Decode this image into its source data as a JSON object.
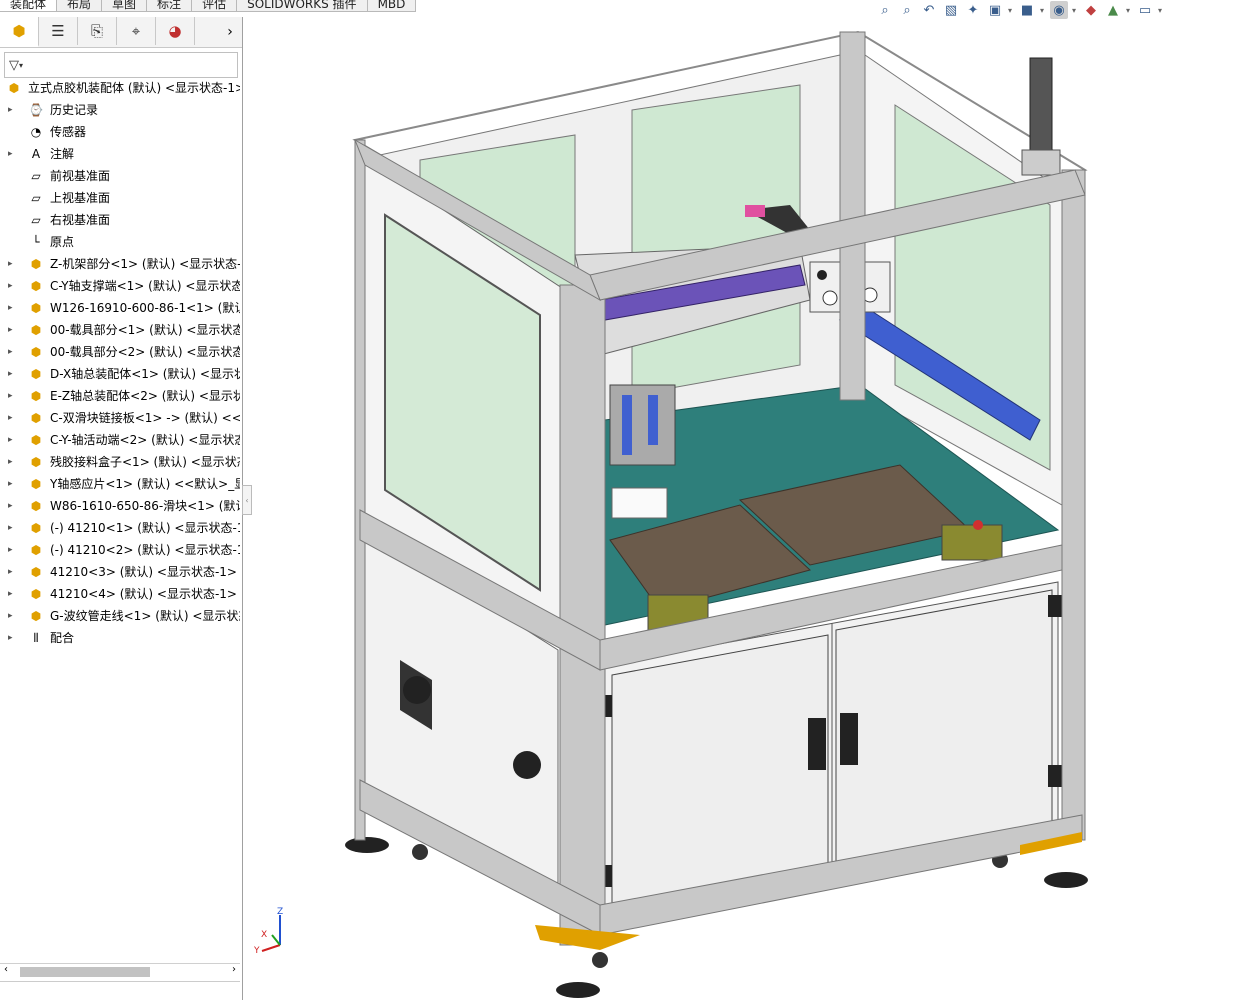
{
  "tabs": [
    "装配体",
    "布局",
    "草图",
    "标注",
    "评估",
    "SOLIDWORKS 插件",
    "MBD"
  ],
  "panel_tabs": [
    "feature-manager",
    "property-manager",
    "configuration-manager",
    "dimxpert-manager",
    "display-manager"
  ],
  "tree": {
    "root": "立式点胶机装配体 (默认) <显示状态-1>",
    "items": [
      {
        "label": "历史记录",
        "icon": "history-icon",
        "expand": true
      },
      {
        "label": "传感器",
        "icon": "sensor-icon",
        "expand": false
      },
      {
        "label": "注解",
        "icon": "annotation-icon",
        "expand": true
      },
      {
        "label": "前视基准面",
        "icon": "plane-icon",
        "expand": false
      },
      {
        "label": "上视基准面",
        "icon": "plane-icon",
        "expand": false
      },
      {
        "label": "右视基准面",
        "icon": "plane-icon",
        "expand": false
      },
      {
        "label": "原点",
        "icon": "origin-icon",
        "expand": false
      },
      {
        "label": "Z-机架部分<1> (默认) <显示状态-1",
        "icon": "subassembly-icon",
        "expand": true
      },
      {
        "label": "C-Y轴支撑端<1> (默认) <显示状态",
        "icon": "subassembly-icon",
        "expand": true
      },
      {
        "label": "W126-16910-600-86-1<1> (默认)",
        "icon": "subassembly-icon",
        "expand": true
      },
      {
        "label": "00-载具部分<1> (默认) <显示状态",
        "icon": "subassembly-icon",
        "expand": true
      },
      {
        "label": "00-载具部分<2> (默认) <显示状态",
        "icon": "subassembly-icon",
        "expand": true
      },
      {
        "label": "D-X轴总装配体<1> (默认) <显示状",
        "icon": "subassembly-icon",
        "expand": true
      },
      {
        "label": "E-Z轴总装配体<2> (默认) <显示状",
        "icon": "subassembly-icon",
        "expand": true
      },
      {
        "label": "C-双滑块链接板<1> -> (默认) <<默",
        "icon": "subassembly-icon",
        "expand": true
      },
      {
        "label": "C-Y-轴活动端<2> (默认) <显示状态",
        "icon": "subassembly-icon",
        "expand": true
      },
      {
        "label": "残胶接料盒子<1> (默认) <显示状态",
        "icon": "subassembly-icon",
        "expand": true
      },
      {
        "label": "Y轴感应片<1> (默认) <<默认>_显",
        "icon": "part-icon",
        "expand": true
      },
      {
        "label": "W86-1610-650-86-滑块<1> (默认",
        "icon": "subassembly-icon",
        "expand": true
      },
      {
        "label": "(-) 41210<1> (默认) <显示状态-1>",
        "icon": "subassembly-icon",
        "expand": true
      },
      {
        "label": "(-) 41210<2> (默认) <显示状态-1>",
        "icon": "subassembly-icon",
        "expand": true
      },
      {
        "label": "41210<3> (默认) <显示状态-1>",
        "icon": "subassembly-icon",
        "expand": true
      },
      {
        "label": "41210<4> (默认) <显示状态-1>",
        "icon": "subassembly-icon",
        "expand": true
      },
      {
        "label": "G-波纹管走线<1> (默认) <显示状态",
        "icon": "subassembly-icon",
        "expand": true
      },
      {
        "label": "配合",
        "icon": "mates-icon",
        "expand": true
      }
    ]
  },
  "filter_icon": "filter-icon",
  "triad": {
    "x": "X",
    "y": "Y",
    "z": "Z"
  },
  "colors": {
    "frame": "#c8c8c8",
    "panel": "#ededed",
    "glass": "#cfe8d2",
    "table": "#2e7f7b",
    "blue": "#3f5fd0",
    "accent": "#e0a000"
  }
}
